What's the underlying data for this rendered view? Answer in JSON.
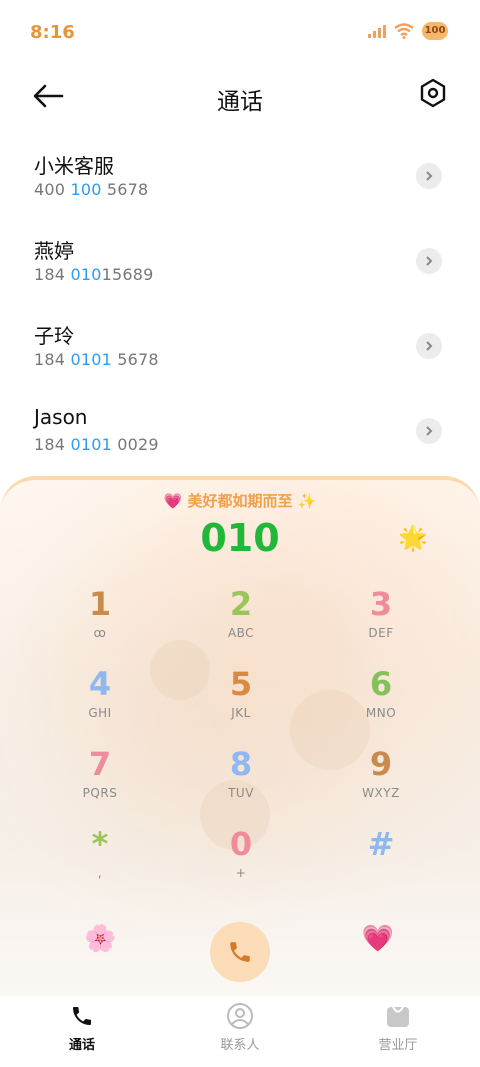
{
  "status": {
    "time": "8:16",
    "battery": "100"
  },
  "header": {
    "title": "通话"
  },
  "results": [
    {
      "name": "小米客服",
      "number_parts": [
        "400 ",
        "100",
        " 5678"
      ]
    },
    {
      "name": "燕婷",
      "number_parts": [
        "184 ",
        "010",
        "15689"
      ]
    },
    {
      "name": "子玲",
      "number_parts": [
        "184 ",
        "0101",
        " 5678"
      ]
    },
    {
      "name": "Jason",
      "number_parts": [
        "184 ",
        "0101",
        " 0029"
      ]
    }
  ],
  "dialer": {
    "slogan": "💗 美好都如期而至 ✨",
    "dialed": "010",
    "star_emoji": "🌟",
    "flower_emoji": "🌸",
    "heart_emoji": "💗",
    "keys": [
      {
        "digit": "1",
        "letters": "ꝏ",
        "color": "#c98b4b"
      },
      {
        "digit": "2",
        "letters": "ABC",
        "color": "#9bc45a"
      },
      {
        "digit": "3",
        "letters": "DEF",
        "color": "#f08b9b"
      },
      {
        "digit": "4",
        "letters": "GHI",
        "color": "#8fb8f0"
      },
      {
        "digit": "5",
        "letters": "JKL",
        "color": "#d88a42"
      },
      {
        "digit": "6",
        "letters": "MNO",
        "color": "#84c15a"
      },
      {
        "digit": "7",
        "letters": "PQRS",
        "color": "#f08b9b"
      },
      {
        "digit": "8",
        "letters": "TUV",
        "color": "#8fb8f0"
      },
      {
        "digit": "9",
        "letters": "WXYZ",
        "color": "#c98b4b"
      },
      {
        "digit": "*",
        "letters": ",",
        "color": "#9bc45a"
      },
      {
        "digit": "0",
        "letters": "+",
        "color": "#f08b9b"
      },
      {
        "digit": "#",
        "letters": "",
        "color": "#8fb8f0"
      }
    ]
  },
  "bottom_nav": {
    "calls": "通话",
    "contacts": "联系人",
    "service": "营业厅"
  },
  "colors": {
    "accent_orange": "#f1a04a",
    "dialed_green": "#21b83a",
    "highlight_blue": "#2d9cf0",
    "call_button_bg": "#fbdcb7"
  }
}
